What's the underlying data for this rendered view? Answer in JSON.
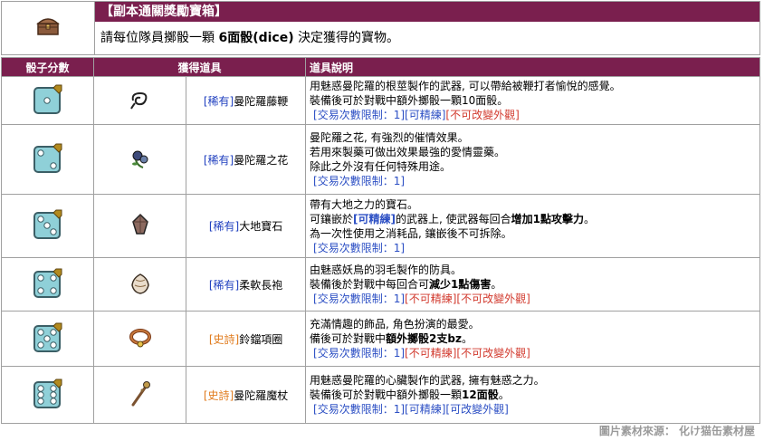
{
  "header": {
    "title": "【副本通關獎勵寶箱】",
    "desc_prefix": "請每位隊員擲骰一顆",
    "desc_bold": "6面骰(dice)",
    "desc_suffix": "決定獲得的寶物。",
    "chest_icon": "treasure-chest-icon"
  },
  "table": {
    "headers": [
      "骰子分數",
      "獲得道具",
      "道具說明"
    ]
  },
  "rows": [
    {
      "dice": 1,
      "item_icon": "vine-whip-icon",
      "rarity": "[稀有]",
      "name": "曼陀羅藤鞭",
      "lines": [
        [
          {
            "t": "用魅惑曼陀羅的根莖製作的武器, 可以帶給被鞭打者愉悅的感覺。"
          }
        ],
        [
          {
            "t": "裝備後可於對戰中額外擲骰一顆10面骰。"
          }
        ],
        [
          {
            "t": "[交易次數限制：1]",
            "c": "blue",
            "i": 1
          },
          {
            "t": "[可精練]",
            "c": "blue"
          },
          {
            "t": "[不可改變外觀]",
            "c": "red"
          }
        ]
      ]
    },
    {
      "dice": 2,
      "item_icon": "mandrake-flower-icon",
      "rarity": "[稀有]",
      "name": "曼陀羅之花",
      "lines": [
        [
          {
            "t": "曼陀羅之花, 有強烈的催情效果。"
          }
        ],
        [
          {
            "t": "若用來製藥可做出效果最強的愛情靈藥。"
          }
        ],
        [
          {
            "t": "除此之外沒有任何特殊用途。"
          }
        ],
        [
          {
            "t": "[交易次數限制：1]",
            "c": "blue",
            "i": 1
          }
        ]
      ]
    },
    {
      "dice": 3,
      "item_icon": "earth-gem-icon",
      "rarity": "[稀有]",
      "name": "大地寶石",
      "lines": [
        [
          {
            "t": "帶有大地之力的寶石。"
          }
        ],
        [
          {
            "t": "可鑲嵌於"
          },
          {
            "t": "[可精練]",
            "c": "blue",
            "b": 1
          },
          {
            "t": "的武器上, 使武器每回合"
          },
          {
            "t": "增加1點攻擊力",
            "b": 1
          },
          {
            "t": "。"
          }
        ],
        [
          {
            "t": "為一次性使用之消耗品, 鑲嵌後不可拆除。"
          }
        ],
        [
          {
            "t": "[交易次數限制：1]",
            "c": "blue",
            "i": 1
          }
        ]
      ]
    },
    {
      "dice": 4,
      "item_icon": "feather-robe-icon",
      "rarity": "[稀有]",
      "name": "柔軟長袍",
      "lines": [
        [
          {
            "t": "由魅惑妖鳥的羽毛製作的防具。"
          }
        ],
        [
          {
            "t": "裝備後於對戰中每回合可"
          },
          {
            "t": "減少1點傷害",
            "b": 1
          },
          {
            "t": "。"
          }
        ],
        [
          {
            "t": "[交易次數限制：1]",
            "c": "blue",
            "i": 1
          },
          {
            "t": "[不可精練]",
            "c": "red"
          },
          {
            "t": "[不可改變外觀]",
            "c": "red"
          }
        ]
      ]
    },
    {
      "dice": 5,
      "item_icon": "bell-collar-icon",
      "rarity": "[史詩]",
      "name": "鈴鐺項圈",
      "lines": [
        [
          {
            "t": "充滿情趣的飾品, 角色扮演的最愛。"
          }
        ],
        [
          {
            "t": "備後可於對戰中"
          },
          {
            "t": "額外擲骰2支bz",
            "b": 1
          },
          {
            "t": "。"
          }
        ],
        [
          {
            "t": "[交易次數限制：1]",
            "c": "blue",
            "i": 1
          },
          {
            "t": "[不可精練]",
            "c": "red"
          },
          {
            "t": "[不可改變外觀]",
            "c": "red"
          }
        ]
      ]
    },
    {
      "dice": 6,
      "item_icon": "mandrake-staff-icon",
      "rarity": "[史詩]",
      "name": "曼陀羅魔杖",
      "lines": [
        [
          {
            "t": "用魅惑曼陀羅的心臟製作的武器, 擁有魅惑之力。"
          }
        ],
        [
          {
            "t": "裝備後可於對戰中額外擲骰一顆"
          },
          {
            "t": "12面骰",
            "b": 1
          },
          {
            "t": "。"
          }
        ],
        [
          {
            "t": "[交易次數限制：1]",
            "c": "blue",
            "i": 1
          },
          {
            "t": "[可精練]",
            "c": "blue"
          },
          {
            "t": "[可改變外觀]",
            "c": "blue"
          }
        ]
      ]
    }
  ],
  "footer": {
    "credit": "圖片素材來源： 化け猫缶素材屋"
  },
  "colors": {
    "header_bg": "#7a1f4e",
    "rare": "#1f3fbf",
    "epic": "#e07b1d",
    "blue_tag": "#2c4fc4",
    "red_tag": "#d23a2e",
    "die_face": "#8fd0d8"
  }
}
